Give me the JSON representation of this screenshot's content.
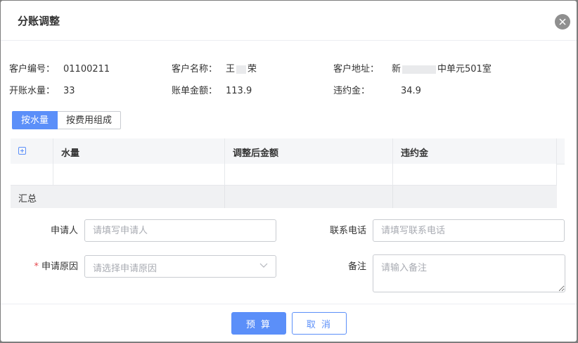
{
  "dialog": {
    "title": "分账调整"
  },
  "info": {
    "customer_no_label": "客户编号：",
    "customer_no": "01100211",
    "customer_name_label": "客户名称：",
    "customer_name_prefix": "王",
    "customer_name_suffix": "荣",
    "customer_addr_label": "客户地址：",
    "customer_addr_prefix": "新",
    "customer_addr_suffix": "中单元501室",
    "open_water_label": "开账水量：",
    "open_water": "33",
    "bill_amount_label": "账单金额：",
    "bill_amount": "113.9",
    "penalty_label": "违约金：",
    "penalty": "34.9"
  },
  "tabs": {
    "by_water": "按水量",
    "by_fee": "按费用组成"
  },
  "table": {
    "columns": [
      "水量",
      "调整后金额",
      "违约金"
    ],
    "summary_label": "汇总"
  },
  "form": {
    "applicant_label": "申请人",
    "applicant_placeholder": "请填写申请人",
    "phone_label": "联系电话",
    "phone_placeholder": "请填写联系电话",
    "reason_required_mark": "*",
    "reason_label": "申请原因",
    "reason_placeholder": "请选择申请原因",
    "remark_label": "备注",
    "remark_placeholder": "请输入备注"
  },
  "footer": {
    "calculate_label": "预 算",
    "cancel_label": "取 消"
  },
  "colors": {
    "accent": "#5b8ff9",
    "required": "#e5484d"
  }
}
